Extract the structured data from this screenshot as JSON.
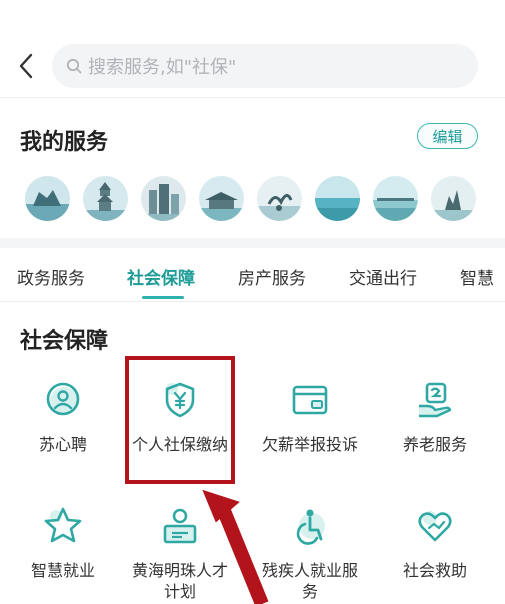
{
  "search": {
    "placeholder": "搜索服务,如\"社保\""
  },
  "my_services": {
    "title": "我的服务",
    "edit_label": "编辑",
    "shortcuts": [
      "city-1",
      "city-2",
      "city-3",
      "city-4",
      "city-5",
      "city-6",
      "city-7",
      "city-8"
    ]
  },
  "tabs": [
    {
      "label": "政务服务",
      "active": false
    },
    {
      "label": "社会保障",
      "active": true
    },
    {
      "label": "房产服务",
      "active": false
    },
    {
      "label": "交通出行",
      "active": false
    },
    {
      "label": "智慧",
      "active": false
    }
  ],
  "section": {
    "title": "社会保障",
    "items": [
      {
        "label": "苏心聘",
        "icon": "person-search-icon"
      },
      {
        "label": "个人社保缴纳",
        "icon": "shield-yuan-icon"
      },
      {
        "label": "欠薪举报投诉",
        "icon": "card-icon"
      },
      {
        "label": "养老服务",
        "icon": "elder-care-icon"
      },
      {
        "label": "智慧就业",
        "icon": "star-icon"
      },
      {
        "label": "黄海明珠人才计划",
        "icon": "talent-id-icon"
      },
      {
        "label": "残疾人就业服务",
        "icon": "wheelchair-icon"
      },
      {
        "label": "社会救助",
        "icon": "heart-hand-icon"
      }
    ]
  },
  "colors": {
    "accent": "#1e9c97",
    "highlight": "#b3141b"
  }
}
